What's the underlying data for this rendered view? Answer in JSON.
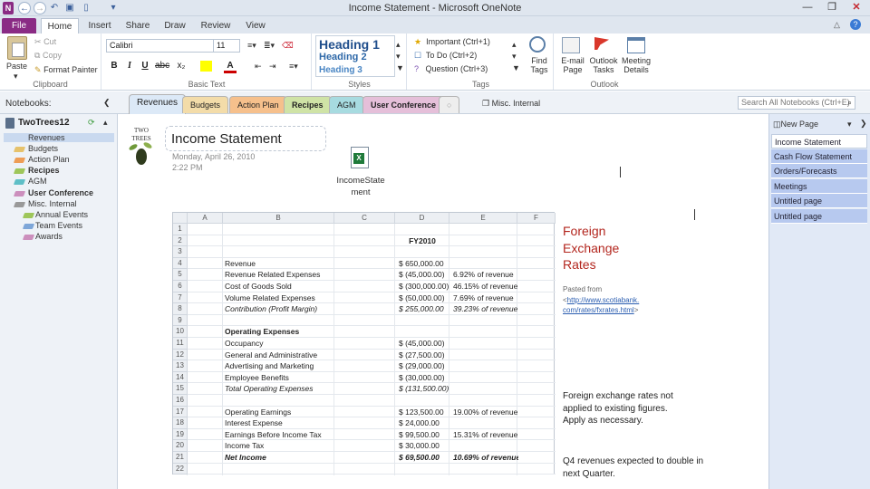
{
  "window": {
    "title": "Income Statement - Microsoft OneNote"
  },
  "ribbon_tabs": [
    "File",
    "Home",
    "Insert",
    "Share",
    "Draw",
    "Review",
    "View"
  ],
  "clipboard": {
    "paste": "Paste",
    "cut": "Cut",
    "copy": "Copy",
    "format_painter": "Format Painter",
    "label": "Clipboard"
  },
  "basic_text": {
    "font": "Calibri",
    "size": "11",
    "label": "Basic Text"
  },
  "styles": {
    "h1": "Heading 1",
    "h2": "Heading 2",
    "h3": "Heading 3",
    "label": "Styles"
  },
  "tags": {
    "important": "Important (Ctrl+1)",
    "todo": "To Do (Ctrl+2)",
    "question": "Question (Ctrl+3)",
    "find_tags": "Find Tags",
    "label": "Tags"
  },
  "outlook": {
    "email": "E-mail Page",
    "tasks": "Outlook Tasks",
    "meeting": "Meeting Details",
    "label": "Outlook"
  },
  "notebooks_label": "Notebooks:",
  "section_tabs": [
    {
      "label": "Revenues",
      "color": "#b9d3ee"
    },
    {
      "label": "Budgets",
      "color": "#f3dca9"
    },
    {
      "label": "Action Plan",
      "color": "#f6c08c"
    },
    {
      "label": "Recipes",
      "color": "#cfe3a6"
    },
    {
      "label": "AGM",
      "color": "#a7dbe0"
    },
    {
      "label": "User Conference",
      "color": "#e5bfd9"
    }
  ],
  "misc_internal": "Misc. Internal",
  "search_placeholder": "Search All Notebooks (Ctrl+E)",
  "notebook": {
    "name": "TwoTrees12",
    "sections": [
      {
        "label": "Revenues",
        "color": "#7ea6d8",
        "bold": false
      },
      {
        "label": "Budgets",
        "color": "#e6c26b",
        "bold": false
      },
      {
        "label": "Action Plan",
        "color": "#ee9d56",
        "bold": false
      },
      {
        "label": "Recipes",
        "color": "#9ec65a",
        "bold": true
      },
      {
        "label": "AGM",
        "color": "#5fbfc7",
        "bold": false
      },
      {
        "label": "User Conference",
        "color": "#cc8fbd",
        "bold": true
      },
      {
        "label": "Misc. Internal",
        "color": "#999999",
        "bold": false
      },
      {
        "label": "Annual Events",
        "color": "#9ec65a",
        "bold": false
      },
      {
        "label": "Team Events",
        "color": "#7ea6d8",
        "bold": false
      },
      {
        "label": "Awards",
        "color": "#cc8fbd",
        "bold": false
      }
    ]
  },
  "page": {
    "title": "Income Statement",
    "date": "Monday, April 26, 2010",
    "time": "2:22 PM",
    "attachment": "IncomeStatement",
    "logo_text": "TWO TREES"
  },
  "sheet": {
    "col_headers": [
      "A",
      "B",
      "C",
      "D",
      "E",
      "F"
    ],
    "year": "FY2010",
    "rows": [
      {
        "n": "1",
        "b": "",
        "d": "",
        "e": ""
      },
      {
        "n": "2",
        "b": "",
        "d": "",
        "e": ""
      },
      {
        "n": "3",
        "b": "",
        "d": "",
        "e": ""
      },
      {
        "n": "4",
        "b": "Revenue",
        "d": "$  650,000.00",
        "e": ""
      },
      {
        "n": "5",
        "b": "Revenue Related Expenses",
        "d": "$  (45,000.00)",
        "e": "6.92% of revenue"
      },
      {
        "n": "6",
        "b": "Cost of Goods Sold",
        "d": "$ (300,000.00)",
        "e": "46.15% of revenue"
      },
      {
        "n": "7",
        "b": "Volume Related Expenses",
        "d": "$  (50,000.00)",
        "e": "7.69% of revenue"
      },
      {
        "n": "8",
        "b": "Contribution (Profit Margin)",
        "d": "$  255,000.00",
        "e": "39.23% of revenue",
        "italic": true
      },
      {
        "n": "9",
        "b": "",
        "d": "",
        "e": ""
      },
      {
        "n": "10",
        "b": "Operating Expenses",
        "d": "",
        "e": "",
        "bold": true
      },
      {
        "n": "11",
        "b": "Occupancy",
        "d": "$  (45,000.00)",
        "e": ""
      },
      {
        "n": "12",
        "b": "General and Administrative",
        "d": "$  (27,500.00)",
        "e": ""
      },
      {
        "n": "13",
        "b": "Advertising and Marketing",
        "d": "$  (29,000.00)",
        "e": ""
      },
      {
        "n": "14",
        "b": "Employee Benefits",
        "d": "$  (30,000.00)",
        "e": ""
      },
      {
        "n": "15",
        "b": "Total Operating Expenses",
        "d": "$ (131,500.00)",
        "e": "",
        "italic": true
      },
      {
        "n": "16",
        "b": "",
        "d": "",
        "e": ""
      },
      {
        "n": "17",
        "b": "Operating Earnings",
        "d": "$  123,500.00",
        "e": "19.00% of revenue"
      },
      {
        "n": "18",
        "b": "Interest Expense",
        "d": "$   24,000.00",
        "e": ""
      },
      {
        "n": "19",
        "b": "Earnings Before Income Tax",
        "d": "$   99,500.00",
        "e": "15.31% of revenue"
      },
      {
        "n": "20",
        "b": "Income Tax",
        "d": "$   30,000.00",
        "e": ""
      },
      {
        "n": "21",
        "b": "Net Income",
        "d": "$   69,500.00",
        "e": "10.69% of revenue",
        "bold": true,
        "italic": true
      },
      {
        "n": "22",
        "b": "",
        "d": "",
        "e": ""
      }
    ]
  },
  "side_note": {
    "heading_lines": [
      "Foreign",
      "Exchange",
      "Rates"
    ],
    "pasted_from": "Pasted from",
    "link1": "http://www.scotiabank.",
    "link2": "com/rates/fxrates.html",
    "note1_l1": "Foreign exchange rates not",
    "note1_l2": "applied to existing figures.",
    "note1_l3": "Apply as necessary.",
    "note2_l1": "Q4 revenues expected to double in",
    "note2_l2": "next Quarter."
  },
  "pages": {
    "new_page": "New Page",
    "items": [
      "Income Statement",
      "Cash Flow Statement",
      "Orders/Forecasts",
      "Meetings",
      "Untitled page",
      "Untitled page"
    ]
  }
}
